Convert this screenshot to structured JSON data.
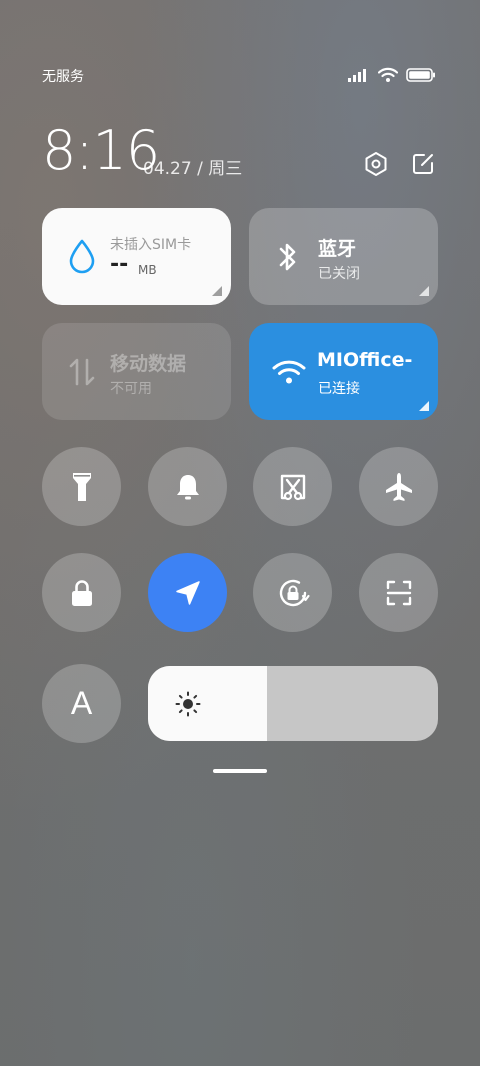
{
  "status_bar": {
    "carrier": "无服务",
    "battery_level": 1.0
  },
  "header": {
    "time": "8:16",
    "date": "04.27 / 周三",
    "settings_icon": "hexagon-settings-icon",
    "edit_icon": "edit-icon"
  },
  "tiles": {
    "data_usage": {
      "label": "未插入SIM卡",
      "value": "--",
      "unit": "MB",
      "icon": "water-drop-icon",
      "accent": "#1e9ff2"
    },
    "bluetooth": {
      "title": "蓝牙",
      "status": "已关闭",
      "icon": "bluetooth-icon"
    },
    "mobile_data": {
      "title": "移动数据",
      "status": "不可用",
      "icon": "mobile-data-arrows-icon"
    },
    "wifi": {
      "title": "MIOffice-",
      "status": "已连接",
      "icon": "wifi-icon",
      "color": "#2b8fe0"
    }
  },
  "toggles": [
    {
      "name": "flashlight",
      "icon": "flashlight-icon",
      "active": false
    },
    {
      "name": "ringer",
      "icon": "bell-icon",
      "active": false
    },
    {
      "name": "screenshot",
      "icon": "scissors-screenshot-icon",
      "active": false
    },
    {
      "name": "airplane-mode",
      "icon": "airplane-icon",
      "active": false
    },
    {
      "name": "lock-screen",
      "icon": "lock-icon",
      "active": false
    },
    {
      "name": "location",
      "icon": "location-arrow-icon",
      "active": true,
      "color": "#3d82f4"
    },
    {
      "name": "rotation-lock",
      "icon": "rotation-lock-icon",
      "active": false
    },
    {
      "name": "scanner",
      "icon": "scan-icon",
      "active": false
    }
  ],
  "auto_brightness": {
    "label": "A",
    "icon": "auto-brightness-icon"
  },
  "brightness": {
    "level": 0.41,
    "icon": "sun-icon"
  }
}
